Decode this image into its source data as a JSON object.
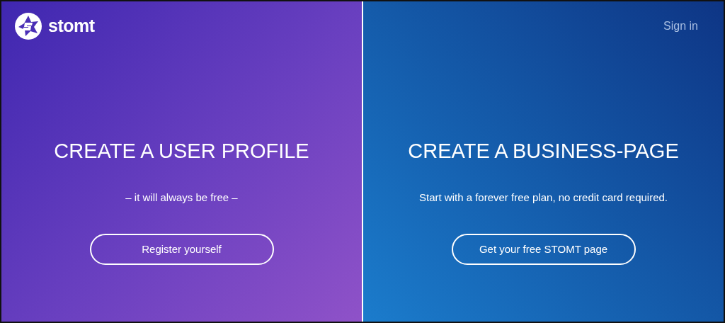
{
  "logo": {
    "text": "stomt"
  },
  "nav": {
    "sign_in": "Sign in"
  },
  "panels": [
    {
      "title": "CREATE A USER PROFILE",
      "subtitle": "– it will always be free –",
      "button": "Register yourself"
    },
    {
      "title": "CREATE A BUSINESS-PAGE",
      "subtitle": "Start with a forever free plan, no credit card required.",
      "button": "Get your free STOMT page"
    }
  ]
}
